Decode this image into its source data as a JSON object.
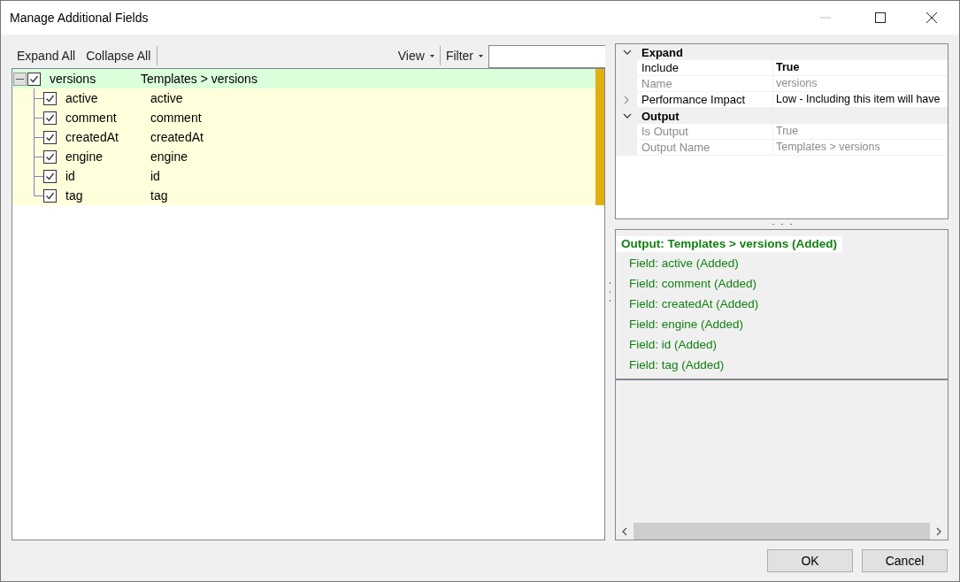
{
  "window": {
    "title": "Manage Additional Fields"
  },
  "toolbar": {
    "buttons": [
      "Expand All",
      "Collapse All"
    ],
    "menus": [
      "View",
      "Filter"
    ]
  },
  "tree": {
    "name": "versions",
    "output": "Templates > versions",
    "checked": true,
    "expanded": true,
    "selected": true,
    "children": [
      {
        "name": "active",
        "output": "active",
        "checked": true,
        "selected": false
      },
      {
        "name": "comment",
        "output": "comment",
        "checked": true,
        "selected": false
      },
      {
        "name": "createdAt",
        "output": "createdAt",
        "checked": true,
        "selected": false
      },
      {
        "name": "engine",
        "output": "engine",
        "checked": true,
        "selected": false
      },
      {
        "name": "id",
        "output": "id",
        "checked": true,
        "selected": false
      },
      {
        "name": "tag",
        "output": "tag",
        "checked": true,
        "selected": false
      }
    ]
  },
  "property_grid": {
    "categories": [
      {
        "label": "Expand",
        "expanded": true,
        "rows": [
          {
            "kind": "plain",
            "name": "Include",
            "value": "True",
            "disabled": false,
            "modified": true
          },
          {
            "kind": "plain",
            "name": "Name",
            "value": "versions",
            "disabled": true,
            "modified": false
          },
          {
            "kind": "expandable",
            "name": "Performance Impact",
            "value": "Low - Including this item will have",
            "disabled": false,
            "modified": false,
            "expanded": false
          }
        ]
      },
      {
        "label": "Output",
        "expanded": true,
        "rows": [
          {
            "kind": "plain",
            "name": "Is Output",
            "value": "True",
            "disabled": true,
            "modified": false
          },
          {
            "kind": "plain",
            "name": "Output Name",
            "value": "Templates > versions",
            "disabled": true,
            "modified": false
          }
        ]
      }
    ]
  },
  "change_log": {
    "header": "Output: Templates > versions (Added)",
    "items": [
      "Field: active (Added)",
      "Field: comment (Added)",
      "Field: createdAt (Added)",
      "Field: engine (Added)",
      "Field: id (Added)",
      "Field: tag (Added)"
    ]
  },
  "buttons": [
    "OK",
    "Cancel"
  ]
}
